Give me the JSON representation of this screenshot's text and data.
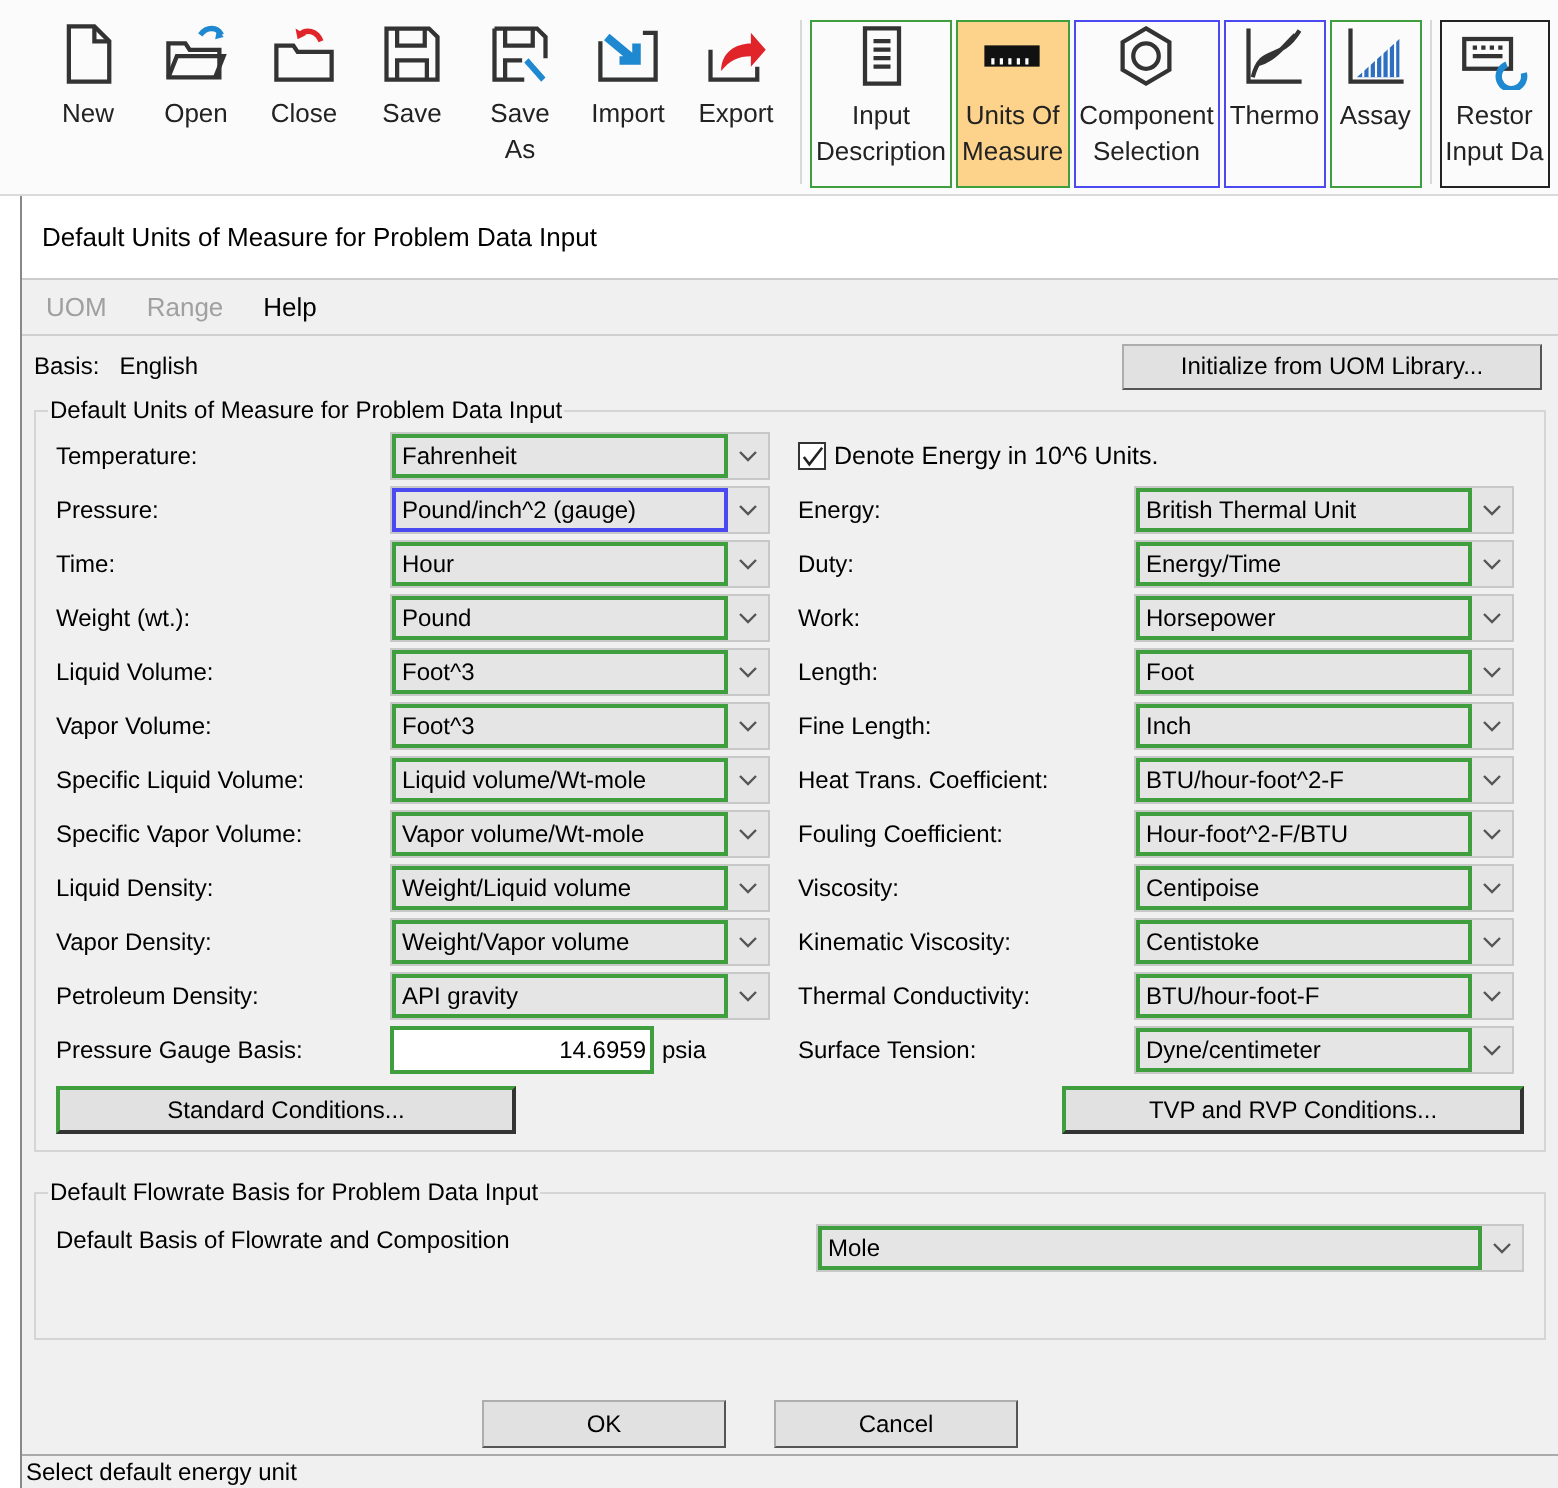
{
  "toolbar": {
    "groups": [
      {
        "buttons": [
          {
            "lines": [
              "New"
            ]
          },
          {
            "lines": [
              "Open"
            ]
          },
          {
            "lines": [
              "Close"
            ]
          },
          {
            "lines": [
              "Save"
            ]
          },
          {
            "lines": [
              "Save",
              "As"
            ]
          },
          {
            "lines": [
              "Import"
            ]
          },
          {
            "lines": [
              "Export"
            ]
          }
        ]
      },
      {
        "buttons": [
          {
            "lines": [
              "Input",
              "Description"
            ],
            "selected": false,
            "color": "#3f9f3f"
          },
          {
            "lines": [
              "Units Of",
              "Measure"
            ],
            "selected": true,
            "color": "#3f9f3f"
          },
          {
            "lines": [
              "Component",
              "Selection"
            ],
            "selected": false,
            "color": "#4a4af0"
          },
          {
            "lines": [
              "Thermo"
            ],
            "selected": false,
            "color": "#4a4af0"
          },
          {
            "lines": [
              "Assay"
            ],
            "selected": false,
            "color": "#3f9f3f"
          }
        ]
      },
      {
        "buttons": [
          {
            "lines": [
              "Restor",
              "Input Da"
            ]
          }
        ]
      }
    ]
  },
  "dialog": {
    "title": "Default Units of Measure for Problem Data Input",
    "menu": [
      {
        "label": "UOM",
        "disabled": true
      },
      {
        "label": "Range",
        "disabled": true
      },
      {
        "label": "Help",
        "disabled": false
      }
    ],
    "basis": {
      "label": "Basis:",
      "value": "English"
    },
    "initialize_button": "Initialize from UOM Library...",
    "units_group": {
      "title": "Default Units of Measure for Problem Data Input",
      "left": [
        {
          "kind": "select",
          "label": "Temperature:",
          "value": "Fahrenheit",
          "color": "#3f9f3f"
        },
        {
          "kind": "select",
          "label": "Pressure:",
          "value": "Pound/inch^2 (gauge)",
          "color": "#4a4af0"
        },
        {
          "kind": "select",
          "label": "Time:",
          "value": "Hour",
          "color": "#3f9f3f"
        },
        {
          "kind": "select",
          "label": "Weight (wt.):",
          "value": "Pound",
          "color": "#3f9f3f"
        },
        {
          "kind": "select",
          "label": "Liquid Volume:",
          "value": "Foot^3",
          "color": "#3f9f3f"
        },
        {
          "kind": "select",
          "label": "Vapor Volume:",
          "value": "Foot^3",
          "color": "#3f9f3f"
        },
        {
          "kind": "select",
          "label": "Specific Liquid Volume:",
          "value": "Liquid volume/Wt-mole",
          "color": "#3f9f3f"
        },
        {
          "kind": "select",
          "label": "Specific Vapor Volume:",
          "value": "Vapor volume/Wt-mole",
          "color": "#3f9f3f"
        },
        {
          "kind": "select",
          "label": "Liquid Density:",
          "value": "Weight/Liquid volume",
          "color": "#3f9f3f"
        },
        {
          "kind": "select",
          "label": "Vapor Density:",
          "value": "Weight/Vapor volume",
          "color": "#3f9f3f"
        },
        {
          "kind": "select",
          "label": "Petroleum Density:",
          "value": "API gravity",
          "color": "#3f9f3f"
        },
        {
          "kind": "number",
          "label": "Pressure Gauge Basis:",
          "value": "14.6959",
          "unit": "psia",
          "color": "#3f9f3f"
        }
      ],
      "right": [
        {
          "kind": "checkbox",
          "label": "Denote Energy in 10^6 Units.",
          "checked": true
        },
        {
          "kind": "select",
          "label": "Energy:",
          "value": "British Thermal Unit",
          "color": "#3f9f3f"
        },
        {
          "kind": "select",
          "label": "Duty:",
          "value": "Energy/Time",
          "color": "#3f9f3f"
        },
        {
          "kind": "select",
          "label": "Work:",
          "value": "Horsepower",
          "color": "#3f9f3f"
        },
        {
          "kind": "select",
          "label": "Length:",
          "value": "Foot",
          "color": "#3f9f3f"
        },
        {
          "kind": "select",
          "label": "Fine Length:",
          "value": "Inch",
          "color": "#3f9f3f"
        },
        {
          "kind": "select",
          "label": "Heat Trans. Coefficient:",
          "value": "BTU/hour-foot^2-F",
          "color": "#3f9f3f"
        },
        {
          "kind": "select",
          "label": "Fouling Coefficient:",
          "value": "Hour-foot^2-F/BTU",
          "color": "#3f9f3f"
        },
        {
          "kind": "select",
          "label": "Viscosity:",
          "value": "Centipoise",
          "color": "#3f9f3f"
        },
        {
          "kind": "select",
          "label": "Kinematic Viscosity:",
          "value": "Centistoke",
          "color": "#3f9f3f"
        },
        {
          "kind": "select",
          "label": "Thermal Conductivity:",
          "value": "BTU/hour-foot-F",
          "color": "#3f9f3f"
        },
        {
          "kind": "select",
          "label": "Surface Tension:",
          "value": "Dyne/centimeter",
          "color": "#3f9f3f"
        }
      ],
      "buttons": [
        {
          "label": "Standard Conditions...",
          "color": "#3f9f3f"
        },
        {
          "label": "TVP and RVP Conditions...",
          "color": "#3f9f3f"
        }
      ]
    },
    "flowrate_group": {
      "title": "Default Flowrate Basis for Problem Data Input",
      "label": "Default Basis of Flowrate and Composition",
      "value": "Mole",
      "color": "#3f9f3f"
    },
    "buttons": [
      "OK",
      "Cancel"
    ],
    "status_bar": "Select default energy unit"
  }
}
